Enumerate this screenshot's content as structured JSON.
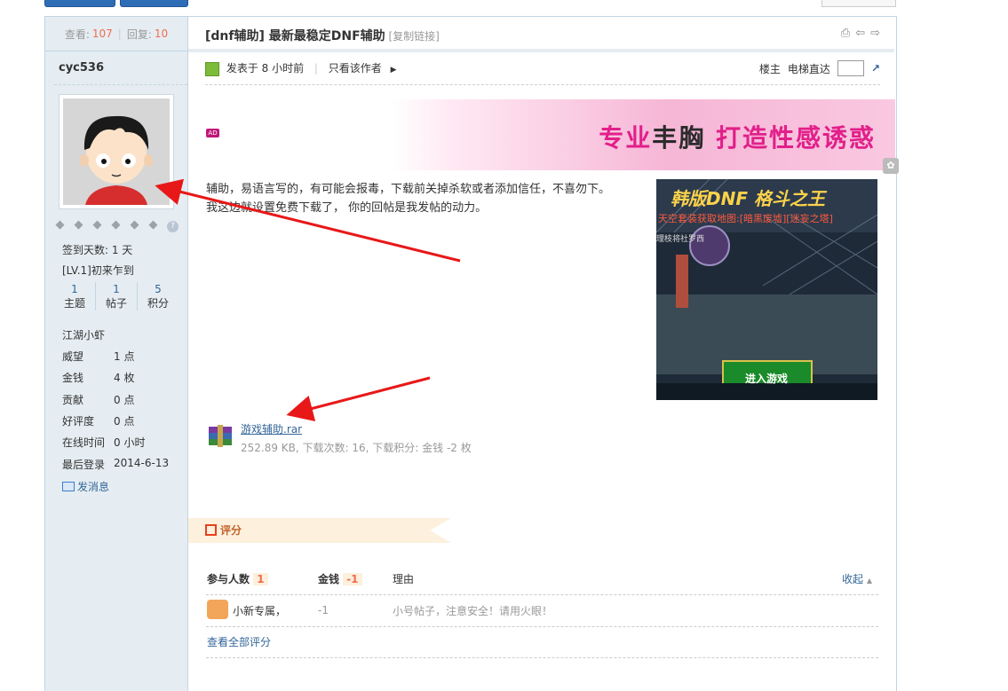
{
  "sidebar": {
    "views_label": "查看:",
    "views": "107",
    "separator": "|",
    "replies_label": "回复:",
    "replies": "10",
    "username": "cyc536",
    "checkin": "签到天数: 1 天",
    "level": "[LV.1]初来乍到",
    "stats": [
      {
        "num": "1",
        "label": "主题"
      },
      {
        "num": "1",
        "label": "帖子"
      },
      {
        "num": "5",
        "label": "积分"
      }
    ],
    "rank": "江湖小虾",
    "fields": [
      {
        "k": "威望",
        "v": "1 点"
      },
      {
        "k": "金钱",
        "v": "4 枚"
      },
      {
        "k": "贡献",
        "v": "0 点"
      },
      {
        "k": "好评度",
        "v": "0 点"
      },
      {
        "k": "在线时间",
        "v": "0 小时"
      },
      {
        "k": "最后登录",
        "v": "2014-6-13"
      }
    ],
    "send_msg": "发消息"
  },
  "post": {
    "title": "[dnf辅助] 最新最稳定DNF辅助",
    "copy_link": "[复制链接]",
    "posted": "发表于 8 小时前",
    "only_author": "只看该作者",
    "floor": "楼主",
    "elevator": "电梯直达",
    "ad_badge": "AD",
    "banner_text_a": "专业",
    "banner_text_b": "丰胸",
    "banner_text_c": " 打造性感诱惑",
    "body_line1": " 辅助，易语言写的，有可能会报毒，下载前关掉杀软或者添加信任，不喜勿下。",
    "body_line2": "我这边就设置免费下载了， 你的回帖是我发帖的动力。",
    "game_title": "韩版DNF 格斗之王",
    "game_sub": "天空套装获取地图:[暗黑废墟][迷妄之塔]",
    "game_left": "理枝将社罗西",
    "game_button": "进入游戏",
    "attachment_name": "游戏辅助.rar",
    "attachment_meta": "252.89 KB, 下载次数: 16, 下载积分: 金钱 -2 枚"
  },
  "rating": {
    "title": "评分",
    "col_people": "参与人数",
    "people_count": "1",
    "col_money": "金钱",
    "money_total": "-1",
    "col_reason": "理由",
    "collapse": "收起",
    "rows": [
      {
        "user": "小新专属，",
        "money": "-1",
        "reason": "小号帖子，注意安全！请用火眼！"
      }
    ],
    "view_all": "查看全部评分"
  },
  "colors": {
    "link": "#336699",
    "accent_red": "#f26c4f",
    "sidebar_bg": "#e5edf2"
  }
}
